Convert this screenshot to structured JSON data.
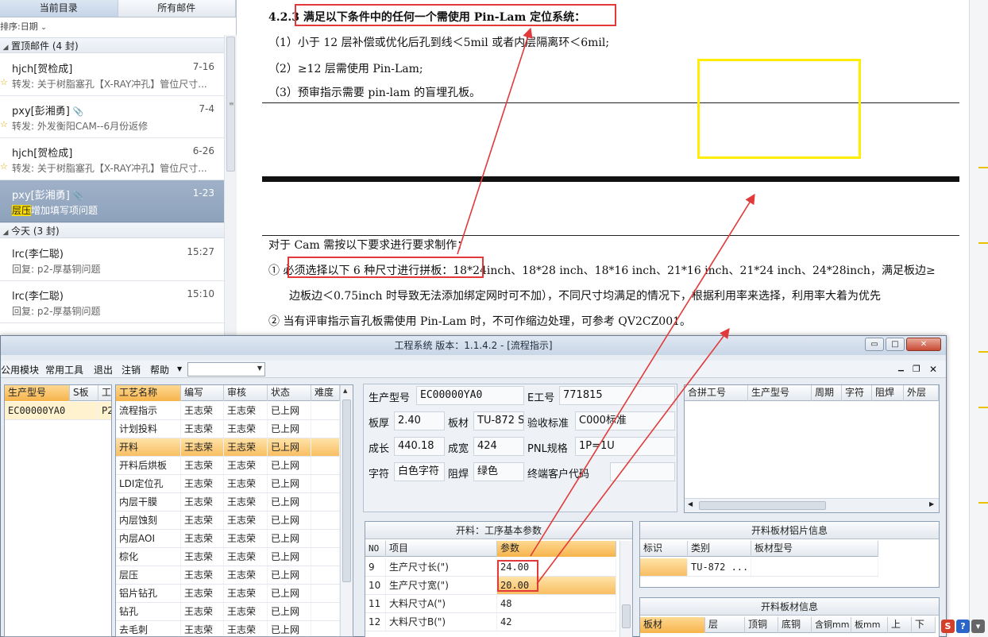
{
  "mail": {
    "tabs": [
      "当前目录",
      "所有邮件"
    ],
    "sort_label": "排序:日期",
    "groups": [
      {
        "title": "置顶邮件 (4 封)"
      },
      {
        "title": "今天 (3 封)"
      }
    ],
    "items": [
      {
        "from": "hjch[贺检成]",
        "date": "7-16",
        "subject": "转发: 关于树脂塞孔【X-RAY冲孔】管位尺寸..."
      },
      {
        "from": "pxy[彭湘勇]",
        "date": "7-4",
        "subject": "转发: 外发衡阳CAM--6月份返修"
      },
      {
        "from": "hjch[贺检成]",
        "date": "6-26",
        "subject": "转发: 关于树脂塞孔【X-RAY冲孔】管位尺寸..."
      },
      {
        "from": "pxy[彭湘勇]",
        "date": "1-23",
        "subject_highlight": "层压",
        "subject_rest": "增加填写项问题"
      },
      {
        "from": "lrc(李仁聪)",
        "date": "15:27",
        "subject": "回复: p2-厚基铜问题"
      },
      {
        "from": "lrc(李仁聪)",
        "date": "15:10",
        "subject": "回复: p2-厚基铜问题"
      }
    ]
  },
  "doc": {
    "heading_num": "4.2.3",
    "heading_text": "满足以下条件中的任何一个需使用 Pin-Lam 定位系统：",
    "lines": [
      "（1）小于 12 层补偿或优化后孔到线＜5mil 或者内层隔离环＜6mil;",
      "（2）≥12 层需使用 Pin-Lam;",
      "（3）预审指示需要 pin-lam 的盲埋孔板。"
    ],
    "para_intro": "对于 Cam 需按以下要求进行要求制作：",
    "item1_num": "①",
    "item1_boxed": "必须选择以下 6 种尺寸进行拼板：",
    "item1_rest": "18*24inch、18*28 inch、18*16 inch、21*16 inch、21*24 inch、24*28inch，满足板边≥",
    "item1_cont": "边板边＜0.75inch 时导致无法添加绑定网时可不加），不同尺寸均满足的情况下，根据利用率来选择，利用率大着为优先",
    "item2": "②   当有评审指示盲孔板需使用 Pin-Lam 时，不可作缩边处理，可参考 QV2CZ001。"
  },
  "app": {
    "title": "工程系统  版本：1.1.4.2 - [流程指示]",
    "menus": [
      "公用模块",
      "常用工具",
      "退出",
      "注销",
      "帮助"
    ],
    "left_grid": {
      "headers": [
        "生产型号",
        "S板",
        "工"
      ],
      "rows": [
        [
          "EC00000YA0",
          "",
          "P2"
        ]
      ]
    },
    "process_grid": {
      "headers": [
        "工艺名称",
        "编写",
        "审核",
        "状态",
        "难度"
      ],
      "rows": [
        [
          "流程指示",
          "王志荣",
          "王志荣",
          "已上网",
          ""
        ],
        [
          "计划投料",
          "王志荣",
          "王志荣",
          "已上网",
          ""
        ],
        [
          "开料",
          "王志荣",
          "王志荣",
          "已上网",
          ""
        ],
        [
          "开料后烘板",
          "王志荣",
          "王志荣",
          "已上网",
          ""
        ],
        [
          "LDI定位孔",
          "王志荣",
          "王志荣",
          "已上网",
          ""
        ],
        [
          "内层干膜",
          "王志荣",
          "王志荣",
          "已上网",
          ""
        ],
        [
          "内层蚀刻",
          "王志荣",
          "王志荣",
          "已上网",
          ""
        ],
        [
          "内层AOI",
          "王志荣",
          "王志荣",
          "已上网",
          ""
        ],
        [
          "棕化",
          "王志荣",
          "王志荣",
          "已上网",
          ""
        ],
        [
          "层压",
          "王志荣",
          "王志荣",
          "已上网",
          ""
        ],
        [
          "铝片钻孔",
          "王志荣",
          "王志荣",
          "已上网",
          ""
        ],
        [
          "钻孔",
          "王志荣",
          "王志荣",
          "已上网",
          ""
        ],
        [
          "去毛刺",
          "王志荣",
          "王志荣",
          "已上网",
          ""
        ]
      ]
    },
    "info": {
      "labels": {
        "model": "生产型号",
        "eno": "E工号",
        "thick": "板厚",
        "mat": "板材",
        "accept": "验收标准",
        "len": "成长",
        "wid": "成宽",
        "pnl": "PNL规格",
        "char": "字符",
        "mask": "阻焊",
        "cust": "终端客户代码"
      },
      "values": {
        "model": "EC00000YA0",
        "eno": "771815",
        "thick": "2.40",
        "mat": "TU-872 S",
        "accept": "C000标准",
        "len": "440.18",
        "wid": "424",
        "pnl": "1P=1U",
        "char": "白色字符",
        "mask": "绿色",
        "cust": ""
      }
    },
    "right_grid": {
      "headers": [
        "合拼工号",
        "生产型号",
        "周期",
        "字符",
        "阻焊",
        "外层"
      ]
    },
    "params": {
      "title": "开料：工序基本参数",
      "headers": [
        "NO",
        "项目",
        "参数"
      ],
      "rows": [
        [
          "9",
          "生产尺寸长(\")",
          "24.00"
        ],
        [
          "10",
          "生产尺寸宽(\")",
          "20.00"
        ],
        [
          "11",
          "大料尺寸A(\")",
          "48"
        ],
        [
          "12",
          "大料尺寸B(\")",
          "42"
        ]
      ]
    },
    "sheet_info": {
      "title": "开料板材铝片信息",
      "headers": [
        "标识",
        "类别",
        "板材型号"
      ],
      "rows": [
        [
          "",
          "TU-872 ...",
          ""
        ]
      ]
    },
    "sheet_info2": {
      "title": "开料板材信息",
      "headers": [
        "板材",
        "层",
        "顶铜",
        "底铜",
        "含铜mm",
        "板mm",
        "上",
        "下"
      ]
    }
  },
  "colors": {
    "highlight": "#ffe000",
    "annotation_red": "#e23a3a",
    "annotation_yellow": "#ffee00",
    "selected_mail": "#97aac2"
  }
}
